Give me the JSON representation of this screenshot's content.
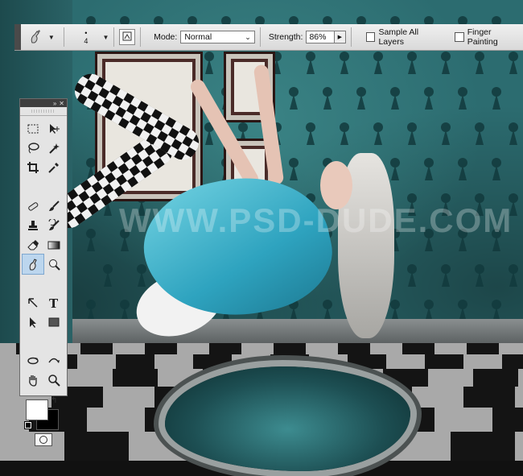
{
  "options_bar": {
    "brush_size": "4",
    "mode_label": "Mode:",
    "mode_value": "Normal",
    "strength_label": "Strength:",
    "strength_value": "86%",
    "sample_all_layers_label": "Sample All Layers",
    "sample_all_layers_checked": false,
    "finger_painting_label": "Finger Painting",
    "finger_painting_checked": false
  },
  "tools_panel": {
    "tools": [
      "rectangular-marquee",
      "move",
      "lasso",
      "magic-wand",
      "crop",
      "eyedropper",
      "spot-healing-brush",
      "brush",
      "clone-stamp",
      "history-brush",
      "eraser",
      "gradient",
      "smudge",
      "dodge",
      "pen",
      "type",
      "path-selection",
      "rectangle",
      "3d-rotate",
      "3d-orbit",
      "hand",
      "zoom"
    ],
    "active_tool": "smudge",
    "foreground_color": "#ffffff",
    "background_color": "#000000"
  },
  "canvas": {
    "watermark": "WWW.PSD-DUDE.COM"
  }
}
